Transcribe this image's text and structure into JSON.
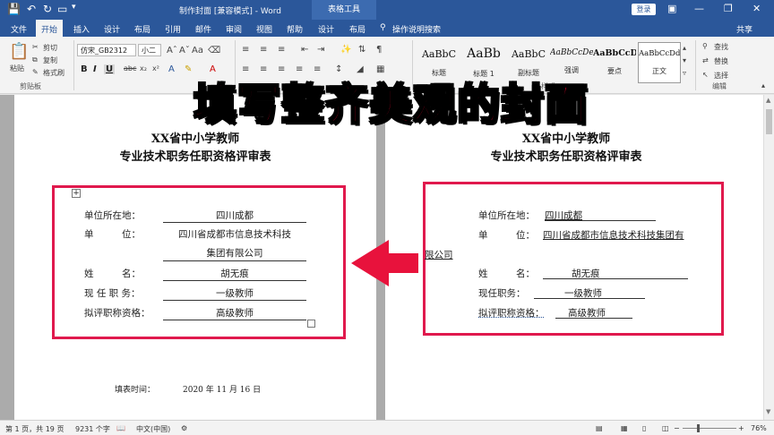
{
  "titlebar": {
    "title": "制作封面 [兼容模式] - Word",
    "table_tools": "表格工具",
    "login": "登录"
  },
  "menu": {
    "tabs": [
      "文件",
      "开始",
      "插入",
      "设计",
      "布局",
      "引用",
      "邮件",
      "审阅",
      "视图",
      "帮助",
      "设计",
      "布局"
    ],
    "tell_me": "操作说明搜索",
    "share": "共享"
  },
  "ribbon": {
    "clipboard": {
      "paste": "粘贴",
      "cut": "剪切",
      "copy": "复制",
      "format_painter": "格式刷",
      "label": "剪贴板"
    },
    "font": {
      "name": "仿宋_GB2312",
      "size": "小二"
    },
    "styles": [
      {
        "sample": "AaBbC",
        "name": "标题"
      },
      {
        "sample": "AaBb",
        "name": "标题 1"
      },
      {
        "sample": "AaBbC",
        "name": "副标题"
      },
      {
        "sample": "AaBbCcDe",
        "name": "强调"
      },
      {
        "sample": "AaBbCcD",
        "name": "要点"
      },
      {
        "sample": "AaBbCcDdI",
        "name": "正文"
      }
    ],
    "styles_label": "样式",
    "editing": {
      "find": "查找",
      "replace": "替换",
      "select": "选择",
      "label": "编辑"
    }
  },
  "banner": "填写整齐美观的封面",
  "left_page": {
    "heading1": "XX省中小学教师",
    "heading2": "专业技术职务任职资格评审表",
    "rows": [
      {
        "label": "单位所在地：",
        "value": "四川成都"
      },
      {
        "label": "单　　　位：",
        "value": "四川省成都市信息技术科技",
        "value2": "集团有限公司"
      },
      {
        "label": "姓　　　名：",
        "value": "胡无痕"
      },
      {
        "label": "现 任 职 务：",
        "value": "一级教师"
      },
      {
        "label": "拟评职称资格：",
        "value": "高级教师"
      }
    ],
    "fill_time_label": "填表时间：",
    "fill_time_value": "2020 年  11  月  16  日"
  },
  "right_page": {
    "heading1": "XX省中小学教师",
    "heading2": "专业技术职务任职资格评审表",
    "rows": [
      {
        "label": "单位所在地：",
        "value": "四川成都"
      },
      {
        "label": "单　　　位：",
        "value": "四川省成都市信息技术科技集团有",
        "value2": "限公司"
      },
      {
        "label": "姓　　　名：",
        "value": "胡无痕"
      },
      {
        "label": "现任职务：",
        "value": "一级教师"
      },
      {
        "label": "拟评职称资格：",
        "value": "高级教师"
      }
    ]
  },
  "status": {
    "page": "第 1 页，共 19 页",
    "words": "9231 个字",
    "lang": "中文(中国)",
    "zoom": "76%"
  },
  "colors": {
    "word_blue": "#2b579a",
    "highlight_red": "#e0194d"
  }
}
